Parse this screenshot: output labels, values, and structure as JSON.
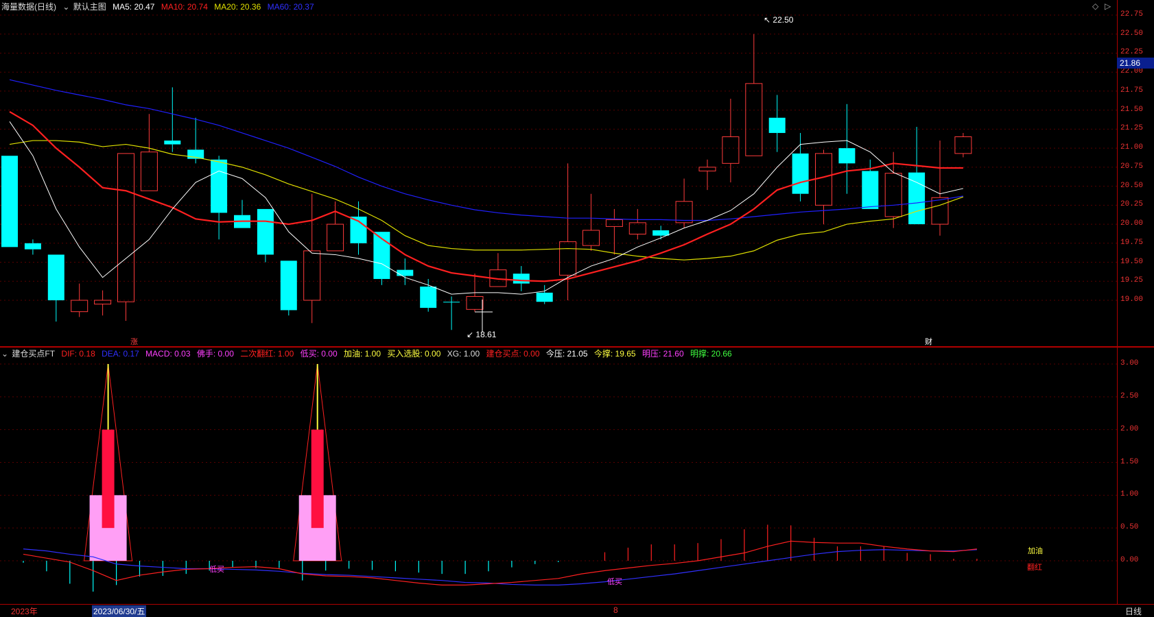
{
  "main_legend": {
    "title": "海量数据(日线)",
    "chart_label": "默认主图",
    "ma5": "MA5: 20.47",
    "ma10": "MA10: 20.74",
    "ma20": "MA20: 20.36",
    "ma60": "MA60: 20.37"
  },
  "ind_legend": {
    "title": "建仓买点FT",
    "dif": "DIF: 0.18",
    "dea": "DEA: 0.17",
    "macd": "MACD: 0.03",
    "fo": "佛手: 0.00",
    "erci": "二次翻红: 1.00",
    "dimai": "低买: 0.00",
    "jiayou": "加油: 1.00",
    "mairu": "买入选股: 0.00",
    "xg": "XG: 1.00",
    "jiancang": "建仓买点: 0.00",
    "jinya": "今压: 21.05",
    "jincheng": "今撑: 19.65",
    "mingya": "明压: 21.60",
    "mingcheng": "明撑: 20.66"
  },
  "price_axis": [
    "22.75",
    "22.50",
    "22.25",
    "22.00",
    "21.75",
    "21.50",
    "21.25",
    "21.00",
    "20.75",
    "20.50",
    "20.25",
    "20.00",
    "19.75",
    "19.50",
    "19.25",
    "19.00"
  ],
  "ind_axis": [
    "3.00",
    "2.50",
    "2.00",
    "1.50",
    "1.00",
    "0.50",
    "0.00"
  ],
  "current_price": "21.86",
  "high_label": "22.50",
  "low_label": "18.61",
  "markers": {
    "zhang": "涨",
    "cai": "财",
    "dimai_1": "低买",
    "dimai_2": "低买",
    "jiayou": "加油",
    "fanhong": "翻红"
  },
  "dates": {
    "start": "2023年",
    "selected": "2023/06/30/五",
    "month": "8",
    "period": "日线"
  },
  "colors": {
    "up": "#ff3b3b",
    "down": "#00ffff",
    "ma5": "#ffffff",
    "ma10": "#ff2020",
    "ma20": "#e0e000",
    "ma60": "#2020ff"
  },
  "chart_data": {
    "type": "candlestick",
    "ylim": [
      18.5,
      22.8
    ],
    "candles": [
      [
        20.9,
        19.7,
        20.9,
        19.7
      ],
      [
        19.75,
        19.67,
        19.8,
        19.6
      ],
      [
        19.6,
        19.0,
        19.6,
        18.72
      ],
      [
        18.85,
        19.0,
        19.22,
        18.78
      ],
      [
        19.0,
        18.95,
        19.13,
        18.8
      ],
      [
        18.98,
        20.93,
        20.93,
        18.73
      ],
      [
        20.44,
        20.95,
        21.45,
        20.44
      ],
      [
        21.1,
        21.05,
        21.8,
        20.95
      ],
      [
        20.98,
        20.86,
        21.4,
        20.8
      ],
      [
        20.85,
        20.15,
        20.9,
        19.8
      ],
      [
        20.12,
        19.95,
        20.32,
        19.95
      ],
      [
        20.2,
        19.6,
        20.2,
        19.5
      ],
      [
        19.52,
        18.87,
        19.52,
        18.8
      ],
      [
        19.0,
        19.65,
        20.4,
        18.7
      ],
      [
        19.65,
        20.0,
        20.3,
        19.65
      ],
      [
        20.1,
        19.75,
        20.3,
        19.6
      ],
      [
        19.9,
        19.28,
        19.9,
        19.2
      ],
      [
        19.4,
        19.32,
        19.55,
        19.2
      ],
      [
        19.18,
        18.9,
        19.28,
        18.85
      ],
      [
        18.98,
        18.98,
        19.05,
        18.61
      ],
      [
        18.88,
        19.05,
        19.35,
        18.85
      ],
      [
        19.18,
        19.4,
        19.62,
        19.18
      ],
      [
        19.35,
        19.22,
        19.45,
        19.12
      ],
      [
        19.1,
        18.98,
        19.2,
        18.95
      ],
      [
        19.33,
        19.77,
        20.8,
        19.0
      ],
      [
        19.72,
        19.92,
        20.4,
        19.65
      ],
      [
        19.97,
        20.06,
        20.2,
        19.6
      ],
      [
        19.87,
        20.02,
        20.2,
        19.8
      ],
      [
        19.92,
        19.85,
        19.98,
        19.8
      ],
      [
        20.02,
        20.3,
        20.6,
        19.95
      ],
      [
        20.7,
        20.75,
        20.85,
        20.45
      ],
      [
        20.8,
        21.15,
        21.65,
        20.55
      ],
      [
        20.9,
        21.85,
        22.5,
        20.9
      ],
      [
        21.4,
        21.2,
        21.7,
        20.95
      ],
      [
        20.93,
        20.4,
        21.2,
        20.3
      ],
      [
        20.25,
        20.93,
        20.98,
        20.0
      ],
      [
        21.0,
        20.8,
        21.58,
        20.4
      ],
      [
        20.2,
        20.7,
        20.85,
        20.2
      ],
      [
        20.67,
        20.1,
        20.95,
        19.95
      ],
      [
        20.68,
        20.0,
        21.28,
        20.0
      ],
      [
        20.0,
        20.35,
        21.1,
        19.85
      ],
      [
        20.93,
        21.15,
        21.2,
        20.88
      ]
    ],
    "up_flags": [
      0,
      0,
      0,
      1,
      1,
      1,
      1,
      0,
      0,
      0,
      0,
      0,
      0,
      1,
      1,
      0,
      0,
      0,
      0,
      0,
      1,
      1,
      0,
      0,
      1,
      1,
      1,
      1,
      0,
      1,
      1,
      1,
      1,
      0,
      0,
      1,
      0,
      0,
      1,
      0,
      1,
      1
    ],
    "ma5": [
      21.35,
      20.9,
      20.2,
      19.7,
      19.3,
      19.55,
      19.8,
      20.2,
      20.55,
      20.7,
      20.6,
      20.35,
      19.9,
      19.62,
      19.6,
      19.55,
      19.48,
      19.3,
      19.2,
      19.08,
      19.1,
      19.1,
      19.08,
      19.12,
      19.3,
      19.45,
      19.55,
      19.7,
      19.82,
      19.95,
      20.05,
      20.18,
      20.4,
      20.75,
      21.05,
      21.08,
      21.1,
      20.95,
      20.68,
      20.55,
      20.4,
      20.47
    ],
    "ma10": [
      21.48,
      21.3,
      21.0,
      20.75,
      20.48,
      20.44,
      20.33,
      20.22,
      20.07,
      20.03,
      20.04,
      20.04,
      20.0,
      20.05,
      20.17,
      20.04,
      19.81,
      19.6,
      19.45,
      19.36,
      19.32,
      19.28,
      19.26,
      19.25,
      19.28,
      19.36,
      19.44,
      19.52,
      19.62,
      19.73,
      19.87,
      20.0,
      20.2,
      20.45,
      20.55,
      20.62,
      20.7,
      20.73,
      20.8,
      20.77,
      20.74,
      20.74
    ],
    "ma20": [
      21.05,
      21.1,
      21.1,
      21.08,
      21.02,
      21.05,
      21.0,
      20.92,
      20.88,
      20.82,
      20.75,
      20.65,
      20.53,
      20.43,
      20.33,
      20.2,
      20.05,
      19.85,
      19.72,
      19.68,
      19.66,
      19.66,
      19.66,
      19.67,
      19.68,
      19.67,
      19.62,
      19.58,
      19.55,
      19.53,
      19.55,
      19.58,
      19.65,
      19.79,
      19.87,
      19.9,
      20.0,
      20.04,
      20.07,
      20.17,
      20.25,
      20.36
    ],
    "ma60": [
      21.9,
      21.83,
      21.76,
      21.7,
      21.64,
      21.57,
      21.52,
      21.45,
      21.38,
      21.3,
      21.2,
      21.1,
      21.0,
      20.88,
      20.76,
      20.62,
      20.5,
      20.4,
      20.32,
      20.25,
      20.19,
      20.15,
      20.12,
      20.1,
      20.08,
      20.08,
      20.07,
      20.06,
      20.06,
      20.05,
      20.05,
      20.07,
      20.1,
      20.13,
      20.16,
      20.18,
      20.2,
      20.23,
      20.25,
      20.28,
      20.32,
      20.37
    ],
    "macd": [
      -0.03,
      -0.16,
      -0.35,
      -0.47,
      -0.37,
      -0.24,
      -0.23,
      -0.2,
      -0.15,
      -0.1,
      -0.11,
      -0.11,
      -0.3,
      -0.15,
      -0.12,
      -0.14,
      -0.16,
      -0.18,
      -0.2,
      -0.2,
      -0.16,
      -0.1,
      -0.05,
      -0.02,
      0.0,
      0.13,
      0.2,
      0.25,
      0.25,
      0.27,
      0.33,
      0.48,
      0.55,
      0.54,
      0.35,
      0.22,
      0.22,
      0.22,
      0.12,
      0.1,
      0.03,
      0.03
    ],
    "dif": [
      0.1,
      0.04,
      -0.02,
      -0.15,
      -0.3,
      -0.22,
      -0.17,
      -0.13,
      -0.12,
      -0.1,
      -0.09,
      -0.12,
      -0.2,
      -0.23,
      -0.24,
      -0.26,
      -0.3,
      -0.34,
      -0.37,
      -0.37,
      -0.35,
      -0.33,
      -0.3,
      -0.27,
      -0.2,
      -0.15,
      -0.11,
      -0.07,
      -0.04,
      0.0,
      0.06,
      0.12,
      0.22,
      0.3,
      0.28,
      0.27,
      0.27,
      0.22,
      0.18,
      0.15,
      0.14,
      0.18
    ],
    "dea": [
      0.18,
      0.15,
      0.1,
      0.06,
      -0.05,
      -0.08,
      -0.1,
      -0.12,
      -0.12,
      -0.13,
      -0.14,
      -0.16,
      -0.19,
      -0.21,
      -0.22,
      -0.24,
      -0.26,
      -0.28,
      -0.3,
      -0.33,
      -0.34,
      -0.36,
      -0.37,
      -0.37,
      -0.35,
      -0.32,
      -0.28,
      -0.24,
      -0.2,
      -0.15,
      -0.1,
      -0.05,
      0.0,
      0.05,
      0.1,
      0.14,
      0.16,
      0.17,
      0.16,
      0.15,
      0.15,
      0.17
    ],
    "signal_bars": [
      {
        "index": 4,
        "pink": 1.0,
        "red_top": 2.0,
        "red_bottom": 0.5,
        "peak": 3.0
      },
      {
        "index": 13,
        "pink": 1.0,
        "red_top": 2.0,
        "red_bottom": 0.5,
        "peak": 3.0
      }
    ]
  }
}
